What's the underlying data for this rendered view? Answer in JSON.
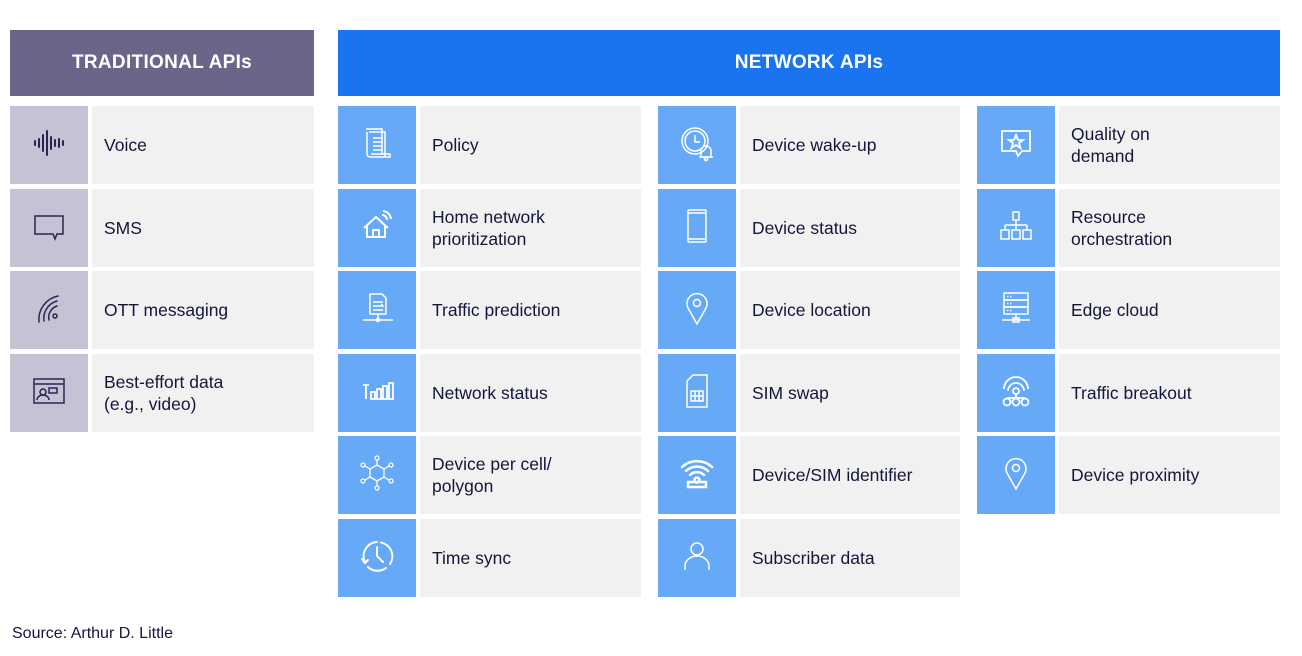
{
  "traditional": {
    "title": "TRADITIONAL APIs",
    "items": [
      {
        "label": "Voice",
        "icon": "sound-wave-icon"
      },
      {
        "label": "SMS",
        "icon": "speech-bubble-icon"
      },
      {
        "label": "OTT messaging",
        "icon": "signal-waves-icon"
      },
      {
        "label": "Best-effort data\n(e.g., video)",
        "icon": "video-call-window-icon"
      }
    ]
  },
  "network": {
    "title": "NETWORK APIs",
    "columns": [
      [
        {
          "label": "Policy",
          "icon": "document-scroll-icon"
        },
        {
          "label": "Home network\nprioritization",
          "icon": "smart-home-icon"
        },
        {
          "label": "Traffic prediction",
          "icon": "network-document-icon"
        },
        {
          "label": "Network status",
          "icon": "signal-bars-icon"
        },
        {
          "label": "Device per cell/\npolygon",
          "icon": "hexagon-nodes-icon"
        },
        {
          "label": "Time sync",
          "icon": "clock-sync-icon"
        }
      ],
      [
        {
          "label": "Device wake-up",
          "icon": "clock-bell-icon"
        },
        {
          "label": "Device status",
          "icon": "smartphone-icon"
        },
        {
          "label": "Device location",
          "icon": "location-pin-icon"
        },
        {
          "label": "SIM swap",
          "icon": "sim-card-icon"
        },
        {
          "label": "Device/SIM identifier",
          "icon": "wireless-beacon-icon"
        },
        {
          "label": "Subscriber data",
          "icon": "user-icon"
        }
      ],
      [
        {
          "label": "Quality on\ndemand",
          "icon": "star-message-icon"
        },
        {
          "label": "Resource\norchestration",
          "icon": "hierarchy-icon"
        },
        {
          "label": "Edge cloud",
          "icon": "server-rack-icon"
        },
        {
          "label": "Traffic breakout",
          "icon": "broadcast-nodes-icon"
        },
        {
          "label": "Device proximity",
          "icon": "location-pin-icon"
        }
      ]
    ]
  },
  "source": "Source: Arthur D. Little"
}
